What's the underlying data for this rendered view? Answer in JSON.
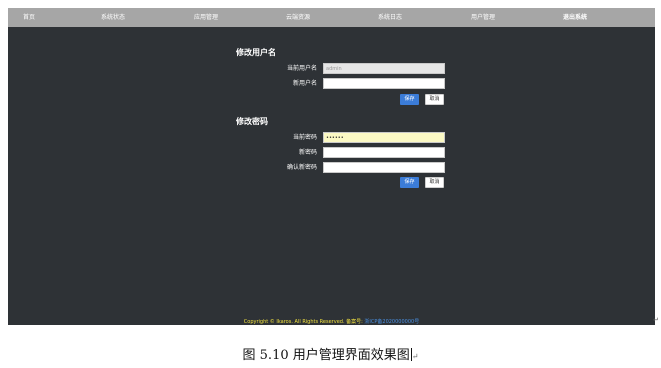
{
  "nav": {
    "items": [
      "首页",
      "系统状态",
      "应用管理",
      "云端资源",
      "系统日志",
      "用户管理",
      "退出系统"
    ]
  },
  "username_section": {
    "title": "修改用户名",
    "current_label": "当前用户名",
    "current_value": "admin",
    "new_label": "新用户名",
    "new_value": "",
    "save_label": "保存",
    "cancel_label": "取消"
  },
  "password_section": {
    "title": "修改密码",
    "current_label": "当前密码",
    "current_value": "••••••",
    "new_label": "新密码",
    "new_value": "",
    "confirm_label": "确认新密码",
    "confirm_value": "",
    "save_label": "保存",
    "cancel_label": "取消"
  },
  "footer": {
    "copyright": "Copyright © Ikaros. All Rights Reserved. 备案号:",
    "icp": "浙ICP备2020000000号"
  },
  "caption": "图 5.10  用户管理界面效果图",
  "colors": {
    "nav_bg": "#a6a6a6",
    "page_bg": "#2e3236",
    "primary": "#3b7cd8",
    "footer_text": "#f0e040",
    "icp_link": "#4a90e2",
    "password_fill": "#fbf9c4"
  }
}
